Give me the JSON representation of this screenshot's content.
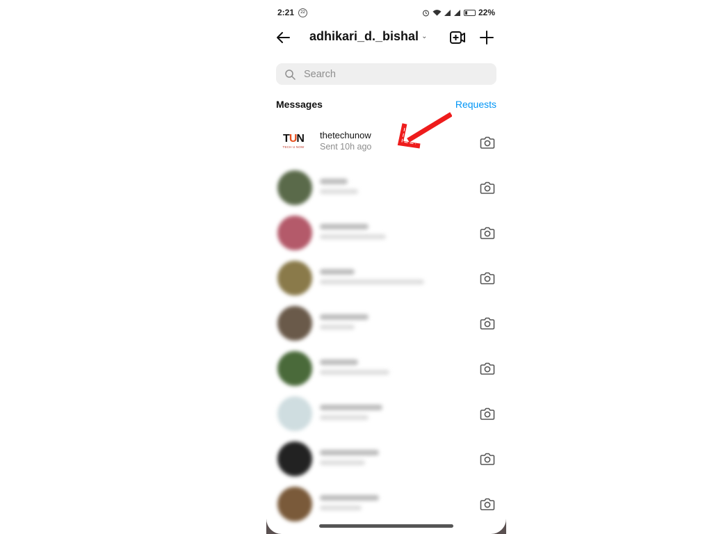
{
  "status_bar": {
    "time": "2:21",
    "notification_badge": "22",
    "battery": "22%",
    "icons": [
      "alarm-icon",
      "wifi-icon",
      "signal-icon",
      "signal-icon",
      "battery-icon"
    ]
  },
  "header": {
    "username": "adhikari_d._bishal",
    "dropdown_icon": "chevron-down-icon",
    "back_icon": "arrow-left-icon",
    "video_icon": "video-add-icon",
    "new_message_icon": "plus-icon"
  },
  "search": {
    "placeholder": "Search"
  },
  "section": {
    "title": "Messages",
    "requests_label": "Requests"
  },
  "colors": {
    "accent": "#0095f6",
    "annotation_arrow": "#ee1c1c",
    "logo_orange": "#e8501e"
  },
  "conversations": [
    {
      "name": "thetechunow",
      "subtitle": "Sent 10h ago",
      "avatar_text": "TUN",
      "avatar_caption": "TECH U NOW",
      "blurred": false
    },
    {
      "name": "",
      "subtitle": "",
      "blurred": true,
      "avatar_color": "#5a6a4a"
    },
    {
      "name": "",
      "subtitle": "",
      "blurred": true,
      "avatar_color": "#b45a6a"
    },
    {
      "name": "",
      "subtitle": "",
      "blurred": true,
      "avatar_color": "#8a7a4a"
    },
    {
      "name": "",
      "subtitle": "",
      "blurred": true,
      "avatar_color": "#6a5a4a"
    },
    {
      "name": "",
      "subtitle": "",
      "blurred": true,
      "avatar_color": "#4a6a3a"
    },
    {
      "name": "",
      "subtitle": "",
      "blurred": true,
      "avatar_color": "#cfdde0"
    },
    {
      "name": "",
      "subtitle": "",
      "blurred": true,
      "avatar_color": "#222222"
    },
    {
      "name": "",
      "subtitle": "",
      "blurred": true,
      "avatar_color": "#7a5a3a"
    }
  ]
}
